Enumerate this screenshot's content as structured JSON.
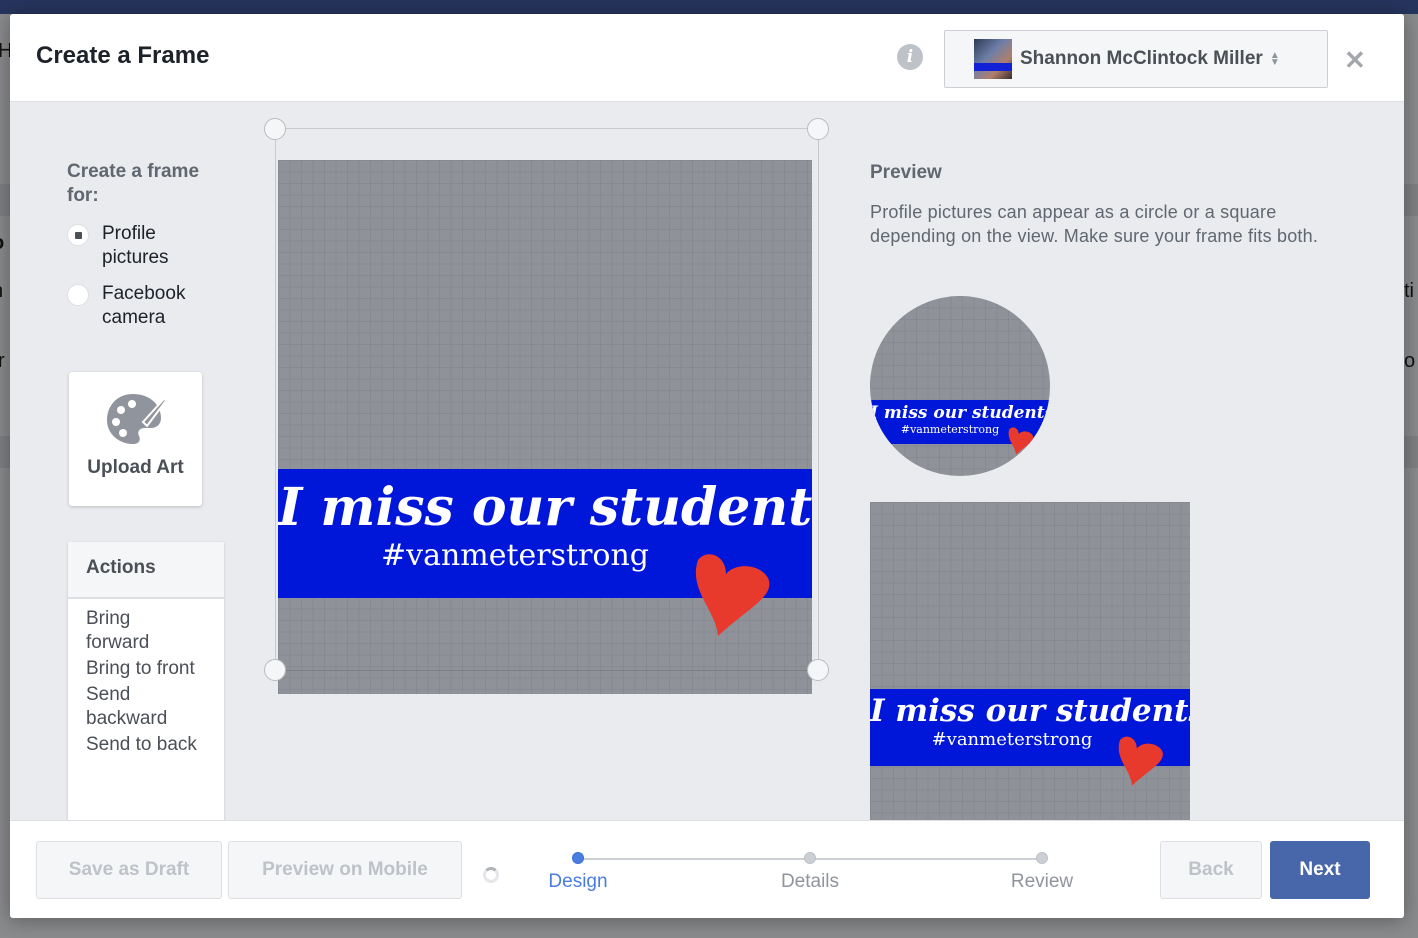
{
  "background": {
    "fragments_left": [
      "H",
      "o",
      "n",
      "r"
    ],
    "fragments_right": [
      "ti",
      "o"
    ]
  },
  "dialog": {
    "title": "Create a Frame",
    "info_icon": "info-icon",
    "page_selector": {
      "name": "Shannon McClintock Miller",
      "icon": "sort-arrows-icon"
    },
    "close_icon": "close-icon"
  },
  "left_panel": {
    "frame_for_label": "Create a frame for:",
    "options": [
      {
        "label": "Profile pictures",
        "checked": true
      },
      {
        "label": "Facebook camera",
        "checked": false
      }
    ],
    "upload_art": {
      "label": "Upload Art",
      "icon": "palette-icon"
    },
    "actions": {
      "header": "Actions",
      "items": [
        "Bring forward",
        "Bring to front",
        "Send backward",
        "Send to back"
      ]
    }
  },
  "frame_art": {
    "script_text": "I miss our students!",
    "hashtag": "#vanmeterstrong",
    "banner_color": "#0016d9",
    "heart_color": "#e8392d",
    "background_color": "#8f9299"
  },
  "preview": {
    "title": "Preview",
    "description": "Profile pictures can appear as a circle or a square depending on the view. Make sure your frame fits both."
  },
  "footer": {
    "save_draft": "Save as Draft",
    "preview_mobile": "Preview on Mobile",
    "steps": [
      {
        "label": "Design",
        "active": true
      },
      {
        "label": "Details",
        "active": false
      },
      {
        "label": "Review",
        "active": false
      }
    ],
    "back": "Back",
    "next": "Next"
  },
  "colors": {
    "primary": "#4867aa",
    "step_active": "#4a7de2"
  }
}
